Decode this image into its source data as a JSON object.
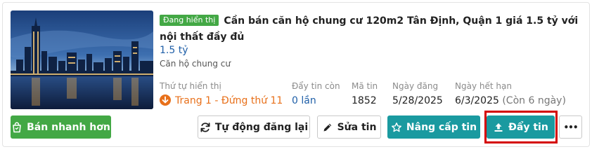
{
  "listing": {
    "status_badge": "Đang hiển thị",
    "title": "Cần bán căn hộ chung cư 120m2 Tân Định, Quận 1 giá 1.5 tỷ với nội thất đầy đủ",
    "price": "1.5 tỷ",
    "category": "Căn hộ chung cư"
  },
  "stats": {
    "display_order": {
      "label": "Thứ tự hiển thị",
      "value": "Trang 1 - Đứng thứ 11"
    },
    "push_remaining": {
      "label": "Đẩy tin còn",
      "value": "0 lần"
    },
    "listing_id": {
      "label": "Mã tin",
      "value": "1852"
    },
    "post_date": {
      "label": "Ngày đăng",
      "value": "5/28/2025"
    },
    "expiry": {
      "label": "Ngày hết hạn",
      "value": "6/3/2025",
      "remaining": "(Còn 6 ngày)"
    }
  },
  "actions": {
    "sell_faster": "Bán nhanh hơn",
    "auto_repost": "Tự động đăng lại",
    "edit": "Sửa tin",
    "upgrade": "Nâng cấp tin",
    "push": "Đẩy tin",
    "more": "•••"
  },
  "colors": {
    "green": "#43a845",
    "teal": "#1a9aa0",
    "orange": "#e8701a",
    "blue": "#1f5fa8",
    "highlight": "#d40000"
  }
}
